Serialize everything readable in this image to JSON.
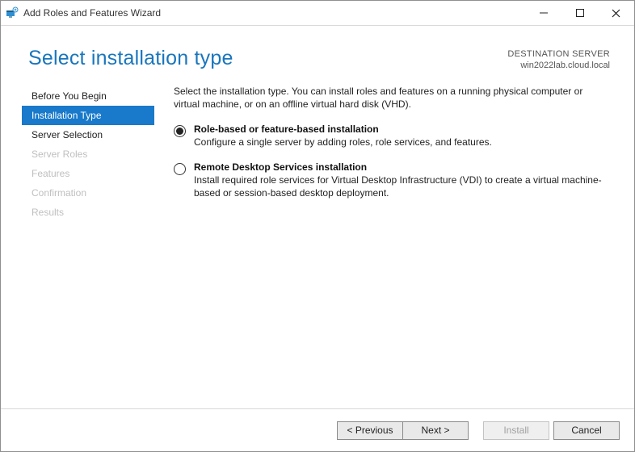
{
  "title": "Add Roles and Features Wizard",
  "page_title": "Select installation type",
  "destination": {
    "label": "DESTINATION SERVER",
    "server": "win2022lab.cloud.local"
  },
  "sidebar": {
    "steps": [
      {
        "label": "Before You Begin",
        "state": "enabled"
      },
      {
        "label": "Installation Type",
        "state": "active"
      },
      {
        "label": "Server Selection",
        "state": "enabled"
      },
      {
        "label": "Server Roles",
        "state": "disabled"
      },
      {
        "label": "Features",
        "state": "disabled"
      },
      {
        "label": "Confirmation",
        "state": "disabled"
      },
      {
        "label": "Results",
        "state": "disabled"
      }
    ]
  },
  "main": {
    "intro": "Select the installation type. You can install roles and features on a running physical computer or virtual machine, or on an offline virtual hard disk (VHD).",
    "options": [
      {
        "checked": true,
        "title": "Role-based or feature-based installation",
        "desc": "Configure a single server by adding roles, role services, and features."
      },
      {
        "checked": false,
        "title": "Remote Desktop Services installation",
        "desc": "Install required role services for Virtual Desktop Infrastructure (VDI) to create a virtual machine-based or session-based desktop deployment."
      }
    ]
  },
  "footer": {
    "previous": "< Previous",
    "next": "Next >",
    "install": "Install",
    "cancel": "Cancel"
  }
}
